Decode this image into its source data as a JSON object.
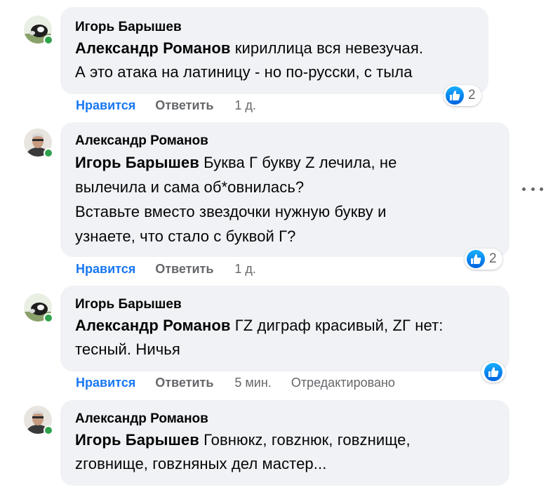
{
  "comments": [
    {
      "author": "Игорь Барышев",
      "mention": "Александр Романов",
      "lines": [
        "кириллица вся невезучая.",
        "А это атака на латиницу - но по-русски, с тыла"
      ],
      "reactions": "2",
      "like": "Нравится",
      "reply": "Ответить",
      "time": "1 д."
    },
    {
      "author": "Александр Романов",
      "mention": "Игорь Барышев",
      "lines": [
        "Буква Г букву Z лечила, не",
        "вылечила и сама об*овнилась?",
        "Вставьте вместо звездочки нужную букву и",
        "узнаете, что стало с буквой Г?"
      ],
      "reactions": "2",
      "like": "Нравится",
      "reply": "Ответить",
      "time": "1 д."
    },
    {
      "author": "Игорь Барышев",
      "mention": "Александр Романов",
      "lines": [
        "ГZ диграф красивый, ZГ нет:",
        "тесный. Ничья"
      ],
      "like": "Нравится",
      "reply": "Ответить",
      "time": "5 мин.",
      "edited": "Отредактировано"
    },
    {
      "author": "Александр Романов",
      "mention": "Игорь Барышев",
      "lines": [
        "Говнюкz, говzнюк, говzнище,",
        "zговнище, говzняных дел мастер..."
      ]
    }
  ],
  "colors": {
    "link": "#1877f2",
    "secondary": "#65676b",
    "bubble": "#f0f2f5",
    "online": "#31a24c"
  }
}
